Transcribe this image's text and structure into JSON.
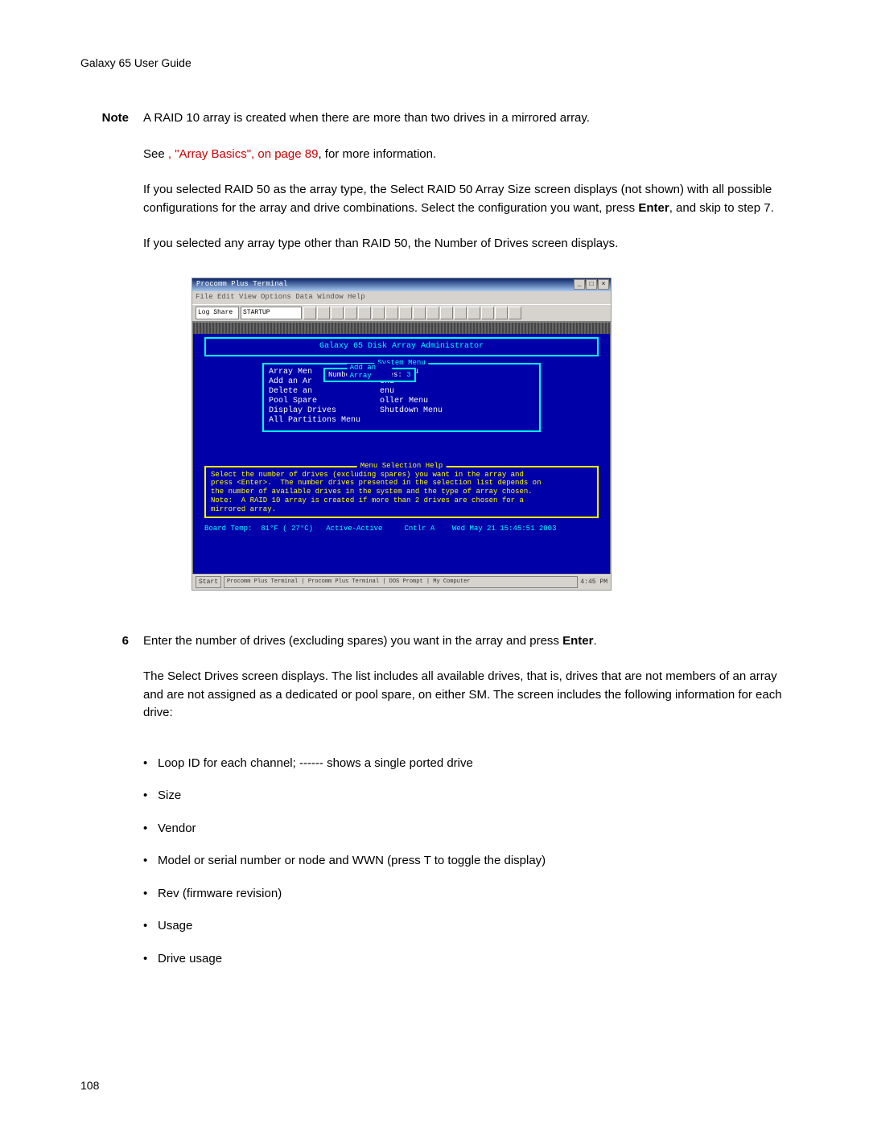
{
  "header": "Galaxy 65 User Guide",
  "note_label": "Note",
  "note_text": "A RAID 10 array is created when there are more than two drives in a mirrored array.",
  "see_prefix": "See ",
  "see_link": ", \"Array Basics\", on page 89",
  "see_suffix": ", for more information.",
  "para_raid50": "If you selected RAID 50 as the array type, the Select RAID 50 Array Size screen displays (not shown) with all possible configurations for the array and drive combinations. Select the configuration you want, press ",
  "enter_bold": "Enter",
  "para_raid50_b": ", and skip to step 7.",
  "para_other": "If you selected any array type other than RAID 50, the Number of Drives screen displays.",
  "screenshot": {
    "title": "Procomm Plus Terminal",
    "menubar": "File  Edit  View  Options  Data  Window  Help",
    "dd1": "Log Share",
    "dd2": "STARTUP",
    "admin_title": "Galaxy 65 Disk Array Administrator",
    "sys_title": "System Menu",
    "sys_lines": "Array Men              ion Menu\nAdd an Ar              enu\nDelete an              enu\nPool Spare             oller Menu\nDisplay Drives         Shutdown Menu\nAll Partitions Menu",
    "popup_title": "Add an Array",
    "popup_label": "Number of Drives:",
    "popup_value": "3",
    "help_title": "Menu Selection Help",
    "help_text": "Select the number of drives (excluding spares) you want in the array and\npress <Enter>.  The number drives presented in the selection list depends on\nthe number of available drives in the system and the type of array chosen.\nNote:  A RAID 10 array is created if more than 2 drives are chosen for a\nmirrored array.",
    "status": "Board Temp:  81°F ( 27°C)   Active-Active     Cntlr A    Wed May 21 15:45:51 2003",
    "taskbar_start": "Start",
    "taskbar_items": "Procomm Plus Terminal | Procomm Plus Terminal | DOS Prompt | My Computer",
    "taskbar_time": "4:45 PM"
  },
  "step6_num": "6",
  "step6_a": "Enter the number of drives (excluding spares) you want in the array and press ",
  "step6_b": ".",
  "step6_para": "The Select Drives screen displays. The list includes all available drives, that is, drives that are not members of an array and are not assigned as a dedicated or pool spare, on either SM. The screen includes the following information for each drive:",
  "bullets": [
    "Loop ID for each channel; ------ shows a single ported drive",
    "Size",
    "Vendor",
    "Model or serial number or node and WWN (press T to toggle the display)",
    "Rev (firmware revision)",
    "Usage",
    "Drive usage"
  ],
  "page_num": "108"
}
